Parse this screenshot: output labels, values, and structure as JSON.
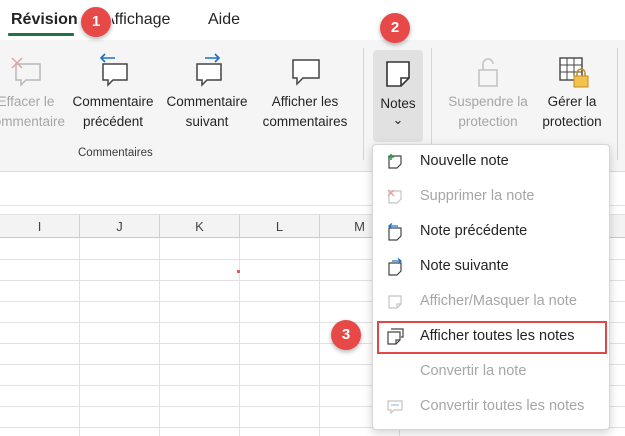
{
  "tabs": [
    {
      "label": "Révision"
    },
    {
      "label": "Affichage"
    },
    {
      "label": "Aide"
    }
  ],
  "ribbon": {
    "delete_comment": {
      "line1": "Effacer le",
      "line2": "commentaire"
    },
    "previous_comment": {
      "line1": "Commentaire",
      "line2": "précédent"
    },
    "next_comment": {
      "line1": "Commentaire",
      "line2": "suivant"
    },
    "show_comments": {
      "line1": "Afficher les",
      "line2": "commentaires"
    },
    "group_comments_label": "Commentaires",
    "notes": {
      "label": "Notes",
      "chevron": "⌄"
    },
    "unprotect": {
      "line1": "Suspendre la",
      "line2": "protection"
    },
    "manage_protection": {
      "line1": "Gérer la",
      "line2": "protection"
    }
  },
  "columns": [
    "I",
    "J",
    "K",
    "L",
    "M"
  ],
  "notes_menu": {
    "items": [
      {
        "label": "Nouvelle note",
        "enabled": true,
        "icon": "new-note-icon"
      },
      {
        "label": "Supprimer la note",
        "enabled": false,
        "icon": "delete-note-icon"
      },
      {
        "label": "Note précédente",
        "enabled": true,
        "icon": "previous-note-icon"
      },
      {
        "label": "Note suivante",
        "enabled": true,
        "icon": "next-note-icon"
      },
      {
        "label": "Afficher/Masquer la note",
        "enabled": false,
        "icon": "show-hide-note-icon"
      },
      {
        "label": "Afficher toutes les notes",
        "enabled": true,
        "icon": "show-all-notes-icon",
        "highlighted": true
      },
      {
        "label": "Convertir la note",
        "enabled": false,
        "icon": "none"
      },
      {
        "label": "Convertir toutes les notes",
        "enabled": false,
        "icon": "convert-all-notes-icon"
      }
    ]
  },
  "callouts": [
    "1",
    "2",
    "3"
  ],
  "colors": {
    "accent": "#217346",
    "callout": "#e74848",
    "disabled": "#a6a6a6"
  }
}
